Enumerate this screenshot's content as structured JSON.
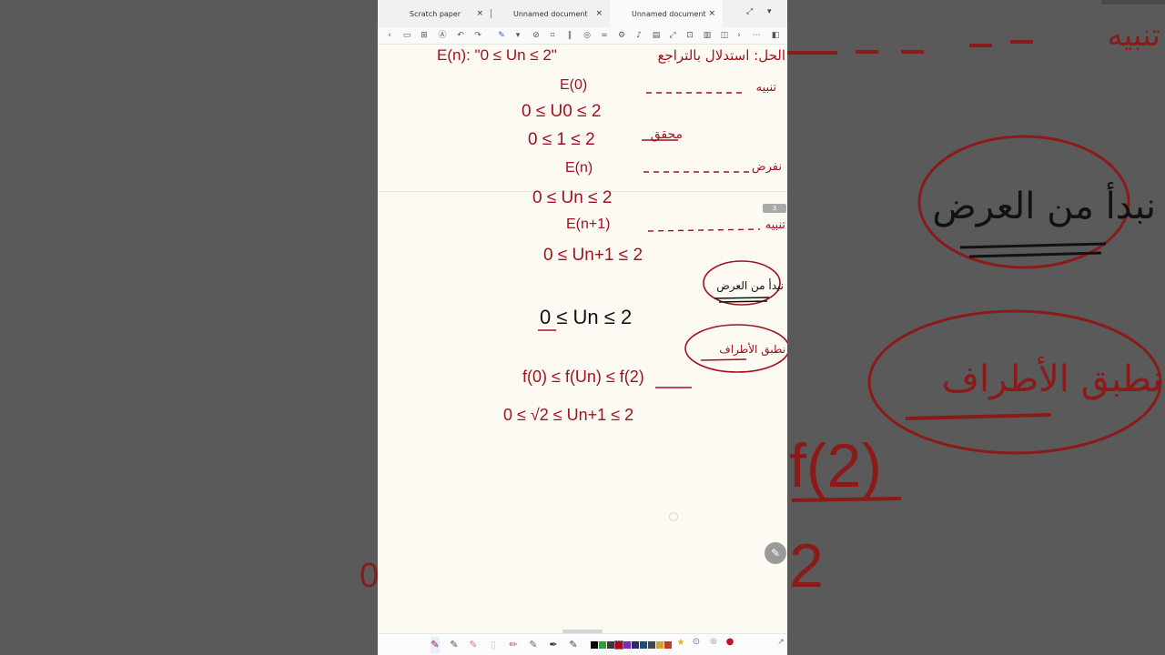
{
  "tabs": [
    {
      "label": "Scratch paper",
      "active": false
    },
    {
      "label": "Unnamed document",
      "active": false
    },
    {
      "label": "Unnamed document",
      "active": true
    }
  ],
  "tab_close_glyph": "×",
  "window_actions": [
    "expand-icon",
    "chevron-down-icon"
  ],
  "toolbar_icons": [
    "back-arrow-icon",
    "sidebar-icon",
    "grid-icon",
    "text-recognize-icon",
    "undo-icon",
    "redo-icon",
    "pen-icon",
    "highlighter-icon",
    "lasso-icon",
    "crop-icon",
    "columns-icon",
    "shapes-icon",
    "link-icon",
    "settings-icon",
    "microphone-icon",
    "scan-icon",
    "fullscreen-icon",
    "add-page-icon",
    "layout-icon",
    "frame-icon",
    "next-icon",
    "more-icon",
    "split-view-icon"
  ],
  "page_badge": "3",
  "notes": {
    "statement": "E(n): \"0 ≤ Un ≤ 2\"",
    "heading_ar": "الحل: استدلال بالتراجع",
    "base_ar": "تنبيه",
    "base_label": "E(0)",
    "base_ineq": "0 ≤ U0 ≤ 2",
    "base_check": "0 ≤ 1 ≤ 2",
    "verified_ar": "محقق",
    "assume_label": "E(n)",
    "assume_ar": "نفرض",
    "assume_ineq": "0 ≤ Un ≤ 2",
    "next_label": "E(n+1)",
    "next_ar": "تنبيه",
    "next_ineq": "0 ≤ Un+1 ≤ 2",
    "start_ar": "نبدأ من العرض",
    "main_ineq": "0 ≤ Un ≤ 2",
    "apply_ar": "نطبق الأطراف",
    "apply_ineq": "f(0) ≤ f(Un) ≤ f(2)",
    "result_ineq": "0 ≤ √2 ≤ Un+1 ≤ 2"
  },
  "zoom_side": {
    "left_digit": "0",
    "right_ar_top": "تنبيه",
    "right_ar_circle1": "نبدأ من العرض",
    "right_ar_circle2": "نطبق الأطراف",
    "right_f2": "f(2)",
    "right_2": "2"
  },
  "pens": [
    "pen-1",
    "pen-2",
    "pen-3",
    "eraser",
    "pencil",
    "marker",
    "fountain-pen",
    "brush",
    "highlighter"
  ],
  "colors": [
    "#000000",
    "#2e9e3a",
    "#3a3a3a",
    "#b00020",
    "#7b2cbf",
    "#2a2a6e",
    "#1f4e79",
    "#444444",
    "#d1a03a",
    "#c0392b"
  ],
  "extra_tools": [
    "favorite-icon",
    "target-icon",
    "add-icon",
    "record-icon"
  ]
}
